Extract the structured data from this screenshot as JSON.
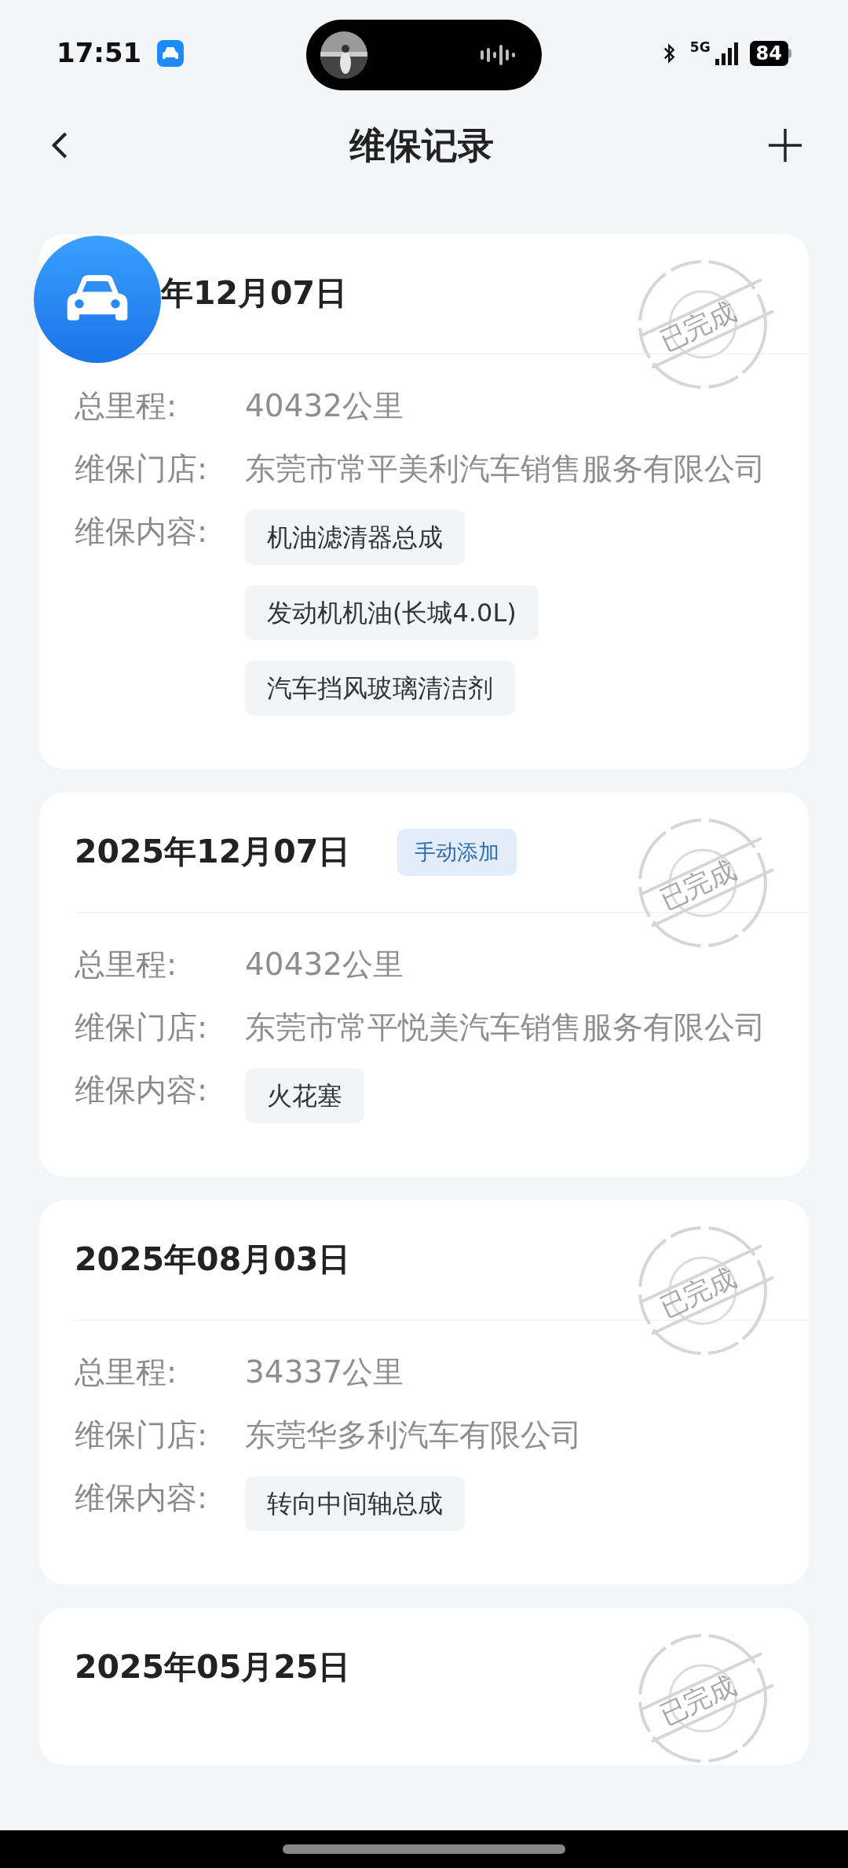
{
  "status_bar": {
    "time": "17:51",
    "network": "5G",
    "battery": "84"
  },
  "header": {
    "title": "维保记录"
  },
  "records": [
    {
      "date": "年12月07日",
      "car_icon": true,
      "status": "已完成",
      "fields": [
        {
          "label": "总里程:",
          "value": "40432公里"
        },
        {
          "label": "维保门店:",
          "value": "东莞市常平美利汽车销售服务有限公司"
        }
      ],
      "content_label": "维保内容:",
      "items": [
        "机油滤清器总成",
        "发动机机油(长城4.0L)",
        "汽车挡风玻璃清洁剂"
      ]
    },
    {
      "date": "2025年12月07日",
      "car_icon": false,
      "tag": "手动添加",
      "status": "已完成",
      "fields": [
        {
          "label": "总里程:",
          "value": "40432公里"
        },
        {
          "label": "维保门店:",
          "value": "东莞市常平悦美汽车销售服务有限公司"
        }
      ],
      "content_label": "维保内容:",
      "items": [
        "火花塞"
      ]
    },
    {
      "date": "2025年08月03日",
      "car_icon": false,
      "status": "已完成",
      "fields": [
        {
          "label": "总里程:",
          "value": "34337公里"
        },
        {
          "label": "维保门店:",
          "value": "东莞华多利汽车有限公司"
        }
      ],
      "content_label": "维保内容:",
      "items": [
        "转向中间轴总成"
      ]
    },
    {
      "date": "2025年05月25日",
      "car_icon": false,
      "status": "已完成"
    }
  ]
}
